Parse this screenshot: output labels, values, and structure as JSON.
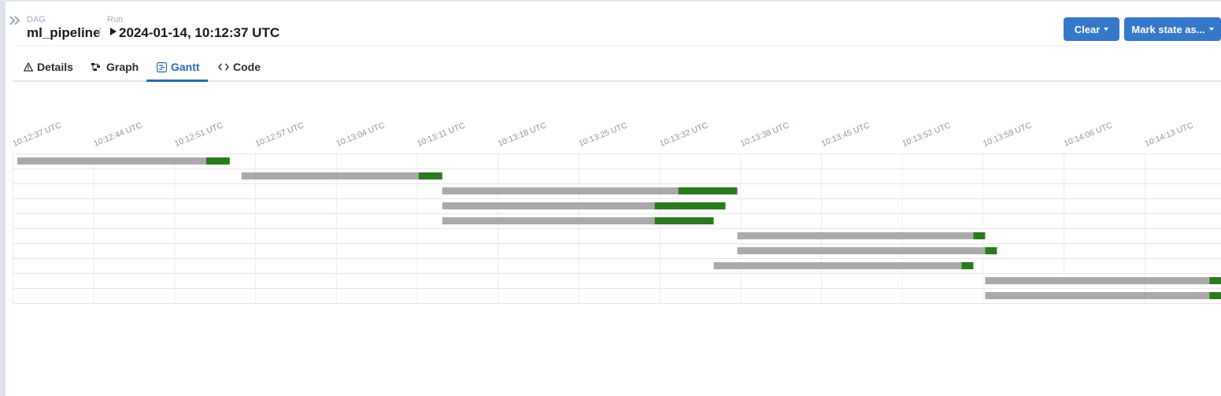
{
  "breadcrumb": {
    "dag_label": "DAG",
    "dag_name": "ml_pipeline",
    "separator": "/",
    "run_label": "Run",
    "run_value": "2024-01-14, 10:12:37 UTC"
  },
  "actions": {
    "clear_label": "Clear",
    "mark_state_label": "Mark state as..."
  },
  "tabs": [
    {
      "label": "Details",
      "icon": "warning-triangle-icon",
      "active": false
    },
    {
      "label": "Graph",
      "icon": "graph-icon",
      "active": false
    },
    {
      "label": "Gantt",
      "icon": "gantt-icon",
      "active": true
    },
    {
      "label": "Code",
      "icon": "code-icon",
      "active": false
    }
  ],
  "colors": {
    "accent": "#3578c9",
    "queued": "#aaaaaa",
    "success": "#2b7a1f",
    "active_tab": "#2b6cb0"
  },
  "gantt": {
    "ticks": [
      "10:12:37 UTC",
      "10:12:44 UTC",
      "10:12:51 UTC",
      "10:12:57 UTC",
      "10:13:04 UTC",
      "10:13:11 UTC",
      "10:13:18 UTC",
      "10:13:25 UTC",
      "10:13:32 UTC",
      "10:13:38 UTC",
      "10:13:45 UTC",
      "10:13:52 UTC",
      "10:13:59 UTC",
      "10:14:06 UTC",
      "10:14:13 UTC"
    ],
    "tasks": [
      {
        "queued_start": "10:12:37",
        "start": "10:12:53",
        "end": "10:12:55",
        "state": "success"
      },
      {
        "queued_start": "10:12:56",
        "start": "10:13:11",
        "end": "10:13:13",
        "state": "success"
      },
      {
        "queued_start": "10:13:13",
        "start": "10:13:33",
        "end": "10:13:38",
        "state": "success"
      },
      {
        "queued_start": "10:13:13",
        "start": "10:13:31",
        "end": "10:13:37",
        "state": "success"
      },
      {
        "queued_start": "10:13:13",
        "start": "10:13:31",
        "end": "10:13:36",
        "state": "success"
      },
      {
        "queued_start": "10:13:38",
        "start": "10:13:58",
        "end": "10:13:59",
        "state": "success"
      },
      {
        "queued_start": "10:13:38",
        "start": "10:13:59",
        "end": "10:14:00",
        "state": "success"
      },
      {
        "queued_start": "10:13:36",
        "start": "10:13:57",
        "end": "10:13:58",
        "state": "success"
      },
      {
        "queued_start": "10:13:59",
        "start": "10:14:18",
        "end": "10:14:19",
        "state": "success"
      },
      {
        "queued_start": "10:13:59",
        "start": "10:14:18",
        "end": "10:14:19",
        "state": "success"
      }
    ]
  }
}
